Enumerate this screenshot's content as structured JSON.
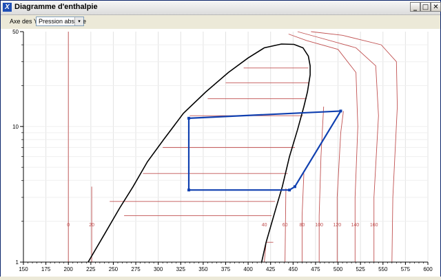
{
  "window": {
    "title": "Diagramme d'enthalpie",
    "icon": "X",
    "buttons": [
      "_",
      "□",
      "✕"
    ]
  },
  "toolbar": {
    "y_axis_label": "Axe des Y :",
    "y_axis_value": "Pression absolue",
    "dropdown_arrow": "▾"
  },
  "chart_data": {
    "type": "line",
    "title": "",
    "xlabel": "",
    "ylabel": "",
    "x_scale": "linear",
    "y_scale": "log",
    "xlim": [
      150,
      600
    ],
    "ylim": [
      1,
      50
    ],
    "x_ticks": [
      150,
      175,
      200,
      225,
      250,
      275,
      300,
      325,
      350,
      375,
      400,
      425,
      450,
      475,
      500,
      525,
      550,
      575,
      600
    ],
    "y_ticks": [
      1,
      10,
      50
    ],
    "grid": true,
    "colors": {
      "dome": "#000000",
      "isotherm": "#c05050",
      "cycle": "#1040b0"
    },
    "saturation_dome": [
      [
        222,
        1
      ],
      [
        240,
        1.6
      ],
      [
        257,
        2.5
      ],
      [
        272,
        3.6
      ],
      [
        288,
        5.5
      ],
      [
        306,
        8
      ],
      [
        328,
        12.5
      ],
      [
        353,
        18
      ],
      [
        378,
        25
      ],
      [
        400,
        32
      ],
      [
        418,
        38
      ],
      [
        437,
        40.5
      ],
      [
        451,
        40.3
      ],
      [
        461,
        38
      ],
      [
        467,
        33
      ],
      [
        469,
        28
      ],
      [
        469,
        24
      ],
      [
        466,
        18
      ],
      [
        462,
        14
      ],
      [
        455,
        9.5
      ],
      [
        446,
        6
      ],
      [
        438,
        3.6
      ],
      [
        431,
        2.5
      ],
      [
        420,
        1.4
      ],
      [
        415,
        1
      ]
    ],
    "isotherm_labels": [
      {
        "label": "0",
        "x": 200,
        "y": 1.9
      },
      {
        "label": "20",
        "x": 226,
        "y": 1.9
      },
      {
        "label": "40",
        "x": 418,
        "y": 1.9
      },
      {
        "label": "60",
        "x": 441,
        "y": 1.9
      },
      {
        "label": "80",
        "x": 460,
        "y": 1.9
      },
      {
        "label": "100",
        "x": 479,
        "y": 1.9
      },
      {
        "label": "120",
        "x": 499,
        "y": 1.9
      },
      {
        "label": "140",
        "x": 519,
        "y": 1.9
      },
      {
        "label": "160",
        "x": 540,
        "y": 1.9
      }
    ],
    "cycle": [
      [
        334,
        11.5
      ],
      [
        503,
        13
      ],
      [
        452,
        3.6
      ],
      [
        446,
        3.4
      ],
      [
        334,
        3.4
      ],
      [
        334,
        11.5
      ]
    ]
  }
}
